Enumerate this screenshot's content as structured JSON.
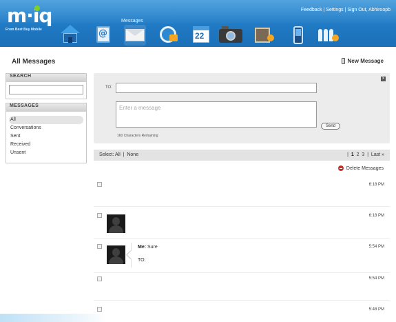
{
  "header": {
    "logo_text": "m·iq",
    "logo_tagline": "From Best Buy Mobile",
    "top_links": "Feedback | Settings | Sign Out, Abhiroopb",
    "nav_active_label": "Messages",
    "nav_icons": [
      "home-icon",
      "contacts-icon",
      "messages-icon",
      "calls-icon",
      "calendar-icon",
      "photos-icon",
      "videos-icon",
      "phone-icon",
      "people-icon"
    ],
    "calendar_number": "22"
  },
  "page": {
    "title": "All Messages",
    "new_message_label": "New Message"
  },
  "sidebar": {
    "search_header": "SEARCH",
    "messages_header": "MESSAGES",
    "items": [
      {
        "label": "All",
        "active": true
      },
      {
        "label": "Conversations"
      },
      {
        "label": "Sent"
      },
      {
        "label": "Received"
      },
      {
        "label": "Unsent"
      }
    ]
  },
  "compose": {
    "to_label": "TO:",
    "to_value": "",
    "message_placeholder": "Enter a message",
    "chars_remaining": "160 Characters Remaining",
    "send_label": "Send",
    "close_label": "x"
  },
  "select_bar": {
    "select_label": "Select:",
    "all": "All",
    "separator": "|",
    "none": "None",
    "pages": [
      "1",
      "2",
      "3"
    ],
    "current_page": "1",
    "last": "Last »"
  },
  "actions": {
    "delete_label": "Delete Messages"
  },
  "messages": [
    {
      "time": "6:18 PM"
    },
    {
      "time": "6:18 PM"
    },
    {
      "time": "5:54 PM",
      "sender": "Me:",
      "text": "Sure",
      "to_label": "TO:"
    },
    {
      "time": "5:54 PM"
    },
    {
      "time": "5:48 PM"
    }
  ],
  "colors": {
    "header_blue": "#1f78c2",
    "accent_orange": "#f5a623",
    "delete_red": "#c9302c"
  }
}
